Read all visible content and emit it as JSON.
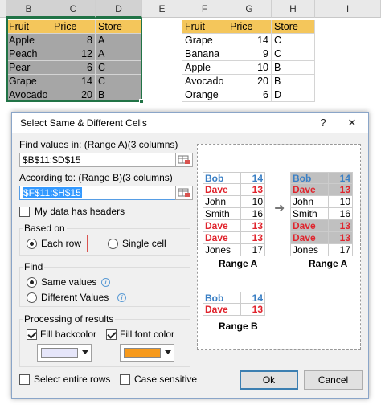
{
  "sheet": {
    "columns": [
      "B",
      "C",
      "D",
      "E",
      "F",
      "G",
      "H",
      "I"
    ],
    "rangeA": {
      "headers": [
        "Fruit",
        "Price",
        "Store"
      ],
      "rows": [
        [
          "Apple",
          "8",
          "A"
        ],
        [
          "Peach",
          "12",
          "A"
        ],
        [
          "Pear",
          "6",
          "C"
        ],
        [
          "Grape",
          "14",
          "C"
        ],
        [
          "Avocado",
          "20",
          "B"
        ]
      ]
    },
    "rangeB": {
      "headers": [
        "Fruit",
        "Price",
        "Store"
      ],
      "rows": [
        [
          "Grape",
          "14",
          "C"
        ],
        [
          "Banana",
          "9",
          "C"
        ],
        [
          "Apple",
          "10",
          "B"
        ],
        [
          "Avocado",
          "20",
          "B"
        ],
        [
          "Orange",
          "6",
          "D"
        ]
      ]
    }
  },
  "dialog": {
    "title": "Select Same & Different Cells",
    "help_glyph": "?",
    "close_glyph": "✕",
    "find_label": "Find values in: (Range A)(3 columns)",
    "find_value": "$B$11:$D$15",
    "according_label": "According to: (Range B)(3 columns)",
    "according_value": "$F$11:$H$15",
    "headers_label": "My data has headers",
    "based_on": {
      "label": "Based on",
      "each_row": "Each row",
      "single_cell": "Single cell"
    },
    "find": {
      "label": "Find",
      "same": "Same values",
      "different": "Different Values"
    },
    "processing": {
      "label": "Processing of results",
      "backcolor": "Fill backcolor",
      "fontcolor": "Fill font color",
      "backcolor_value": "#e6e6fa",
      "fontcolor_value": "#f79a1c"
    },
    "select_rows": "Select entire rows",
    "case_sensitive": "Case sensitive",
    "ok": "Ok",
    "cancel": "Cancel",
    "preview": {
      "rangeA_caption": "Range A",
      "rangeB_caption": "Range B",
      "rangeA_rows": [
        [
          "Bob",
          "14",
          "blue"
        ],
        [
          "Dave",
          "13",
          "red"
        ],
        [
          "John",
          "10",
          "black"
        ],
        [
          "Smith",
          "16",
          "black"
        ],
        [
          "Dave",
          "13",
          "red"
        ],
        [
          "Dave",
          "13",
          "red"
        ],
        [
          "Jones",
          "17",
          "black"
        ]
      ],
      "rangeA_result": [
        [
          "Bob",
          "14",
          "blue",
          true
        ],
        [
          "Dave",
          "13",
          "red",
          true
        ],
        [
          "John",
          "10",
          "black",
          false
        ],
        [
          "Smith",
          "16",
          "black",
          false
        ],
        [
          "Dave",
          "13",
          "red",
          true
        ],
        [
          "Dave",
          "13",
          "red",
          true
        ],
        [
          "Jones",
          "17",
          "black",
          false
        ]
      ],
      "rangeB_rows": [
        [
          "Bob",
          "14",
          "blue"
        ],
        [
          "Dave",
          "13",
          "red"
        ]
      ],
      "arrow": "➜"
    }
  }
}
